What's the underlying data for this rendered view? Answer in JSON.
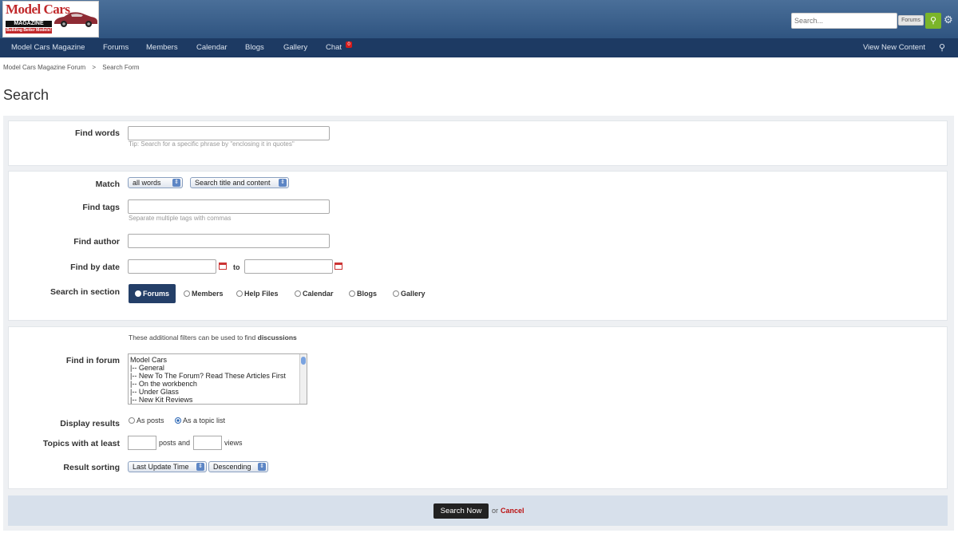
{
  "header": {
    "logo": {
      "line1": "Model Cars",
      "line2": "MAGAZINE",
      "line3": "Building Better Models!"
    },
    "search_placeholder": "Search...",
    "search_scope": "Forums",
    "search_button_icon": "search-icon",
    "settings_icon": "gear-icon"
  },
  "nav": {
    "items": [
      "Model Cars Magazine",
      "Forums",
      "Members",
      "Calendar",
      "Blogs",
      "Gallery",
      "Chat"
    ],
    "chat_badge": "0",
    "view_new": "View New Content",
    "pin_icon": "map-pin-icon"
  },
  "breadcrumb": {
    "root": "Model Cars Magazine Forum",
    "separator": ">",
    "current": "Search Form"
  },
  "page_title": "Search",
  "form": {
    "find_words": {
      "label": "Find words",
      "value": "",
      "tip": "Tip: Search for a specific phrase by \"enclosing it in quotes\""
    },
    "match": {
      "label": "Match",
      "mode": "all words",
      "scope": "Search title and content"
    },
    "find_tags": {
      "label": "Find tags",
      "value": "",
      "hint": "Separate multiple tags with commas"
    },
    "find_author": {
      "label": "Find author",
      "value": ""
    },
    "find_by_date": {
      "label": "Find by date",
      "to": "to",
      "from_value": "",
      "to_value": ""
    },
    "search_in_section": {
      "label": "Search in section",
      "selected": "Forums",
      "options": [
        "Members",
        "Help Files",
        "Calendar",
        "Blogs",
        "Gallery"
      ]
    },
    "filters_note": {
      "prefix": "These additional filters can be used to find",
      "emphasis": "discussions"
    },
    "find_in_forum": {
      "label": "Find in forum",
      "options": [
        "Model Cars",
        "|-- General",
        "|-- New To The Forum? Read These Articles First",
        "|-- On the workbench",
        "|-- Under Glass",
        "|-- New Kit Reviews"
      ]
    },
    "display_results": {
      "label": "Display results",
      "options": [
        "As posts",
        "As a topic list"
      ],
      "selected": "As a topic list"
    },
    "topics_with_at_least": {
      "label": "Topics with at least",
      "posts_label": "posts and",
      "views_label": "views",
      "posts_value": "",
      "views_value": ""
    },
    "result_sorting": {
      "label": "Result sorting",
      "field": "Last Update Time",
      "order": "Descending"
    }
  },
  "actions": {
    "search_now": "Search Now",
    "or": "or",
    "cancel": "Cancel"
  },
  "colors": {
    "header": "#3b6190",
    "nav": "#1d3a63",
    "accent_green": "#7bb52a",
    "section_selected": "#243f68"
  }
}
